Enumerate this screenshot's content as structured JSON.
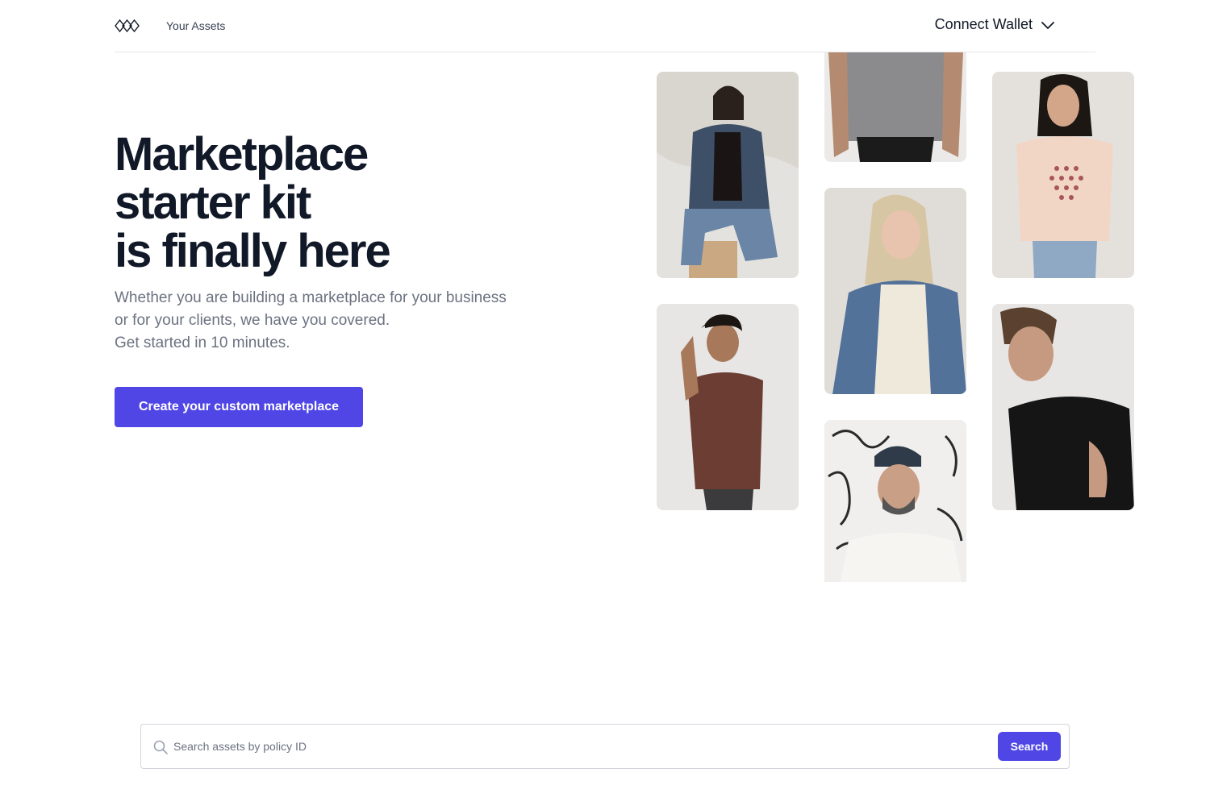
{
  "header": {
    "logo_icon": "diamonds-logo-icon",
    "nav_link": "Your Assets",
    "wallet_label": "Connect Wallet",
    "wallet_icon": "chevron-down-icon"
  },
  "hero": {
    "title_lines": [
      "Marketplace",
      "starter kit",
      "is finally here"
    ],
    "subtitle_lines": [
      "Whether you are building a marketplace for your business",
      "or for your clients, we have you covered.",
      "Get started in 10 minutes."
    ],
    "cta_label": "Create your custom marketplace"
  },
  "search": {
    "placeholder": "Search assets by policy ID",
    "value": "",
    "button_label": "Search",
    "icon": "search-icon"
  },
  "colors": {
    "accent": "#4f46e5",
    "title": "#111827",
    "muted": "#6b7280",
    "border": "#e5e7eb"
  }
}
